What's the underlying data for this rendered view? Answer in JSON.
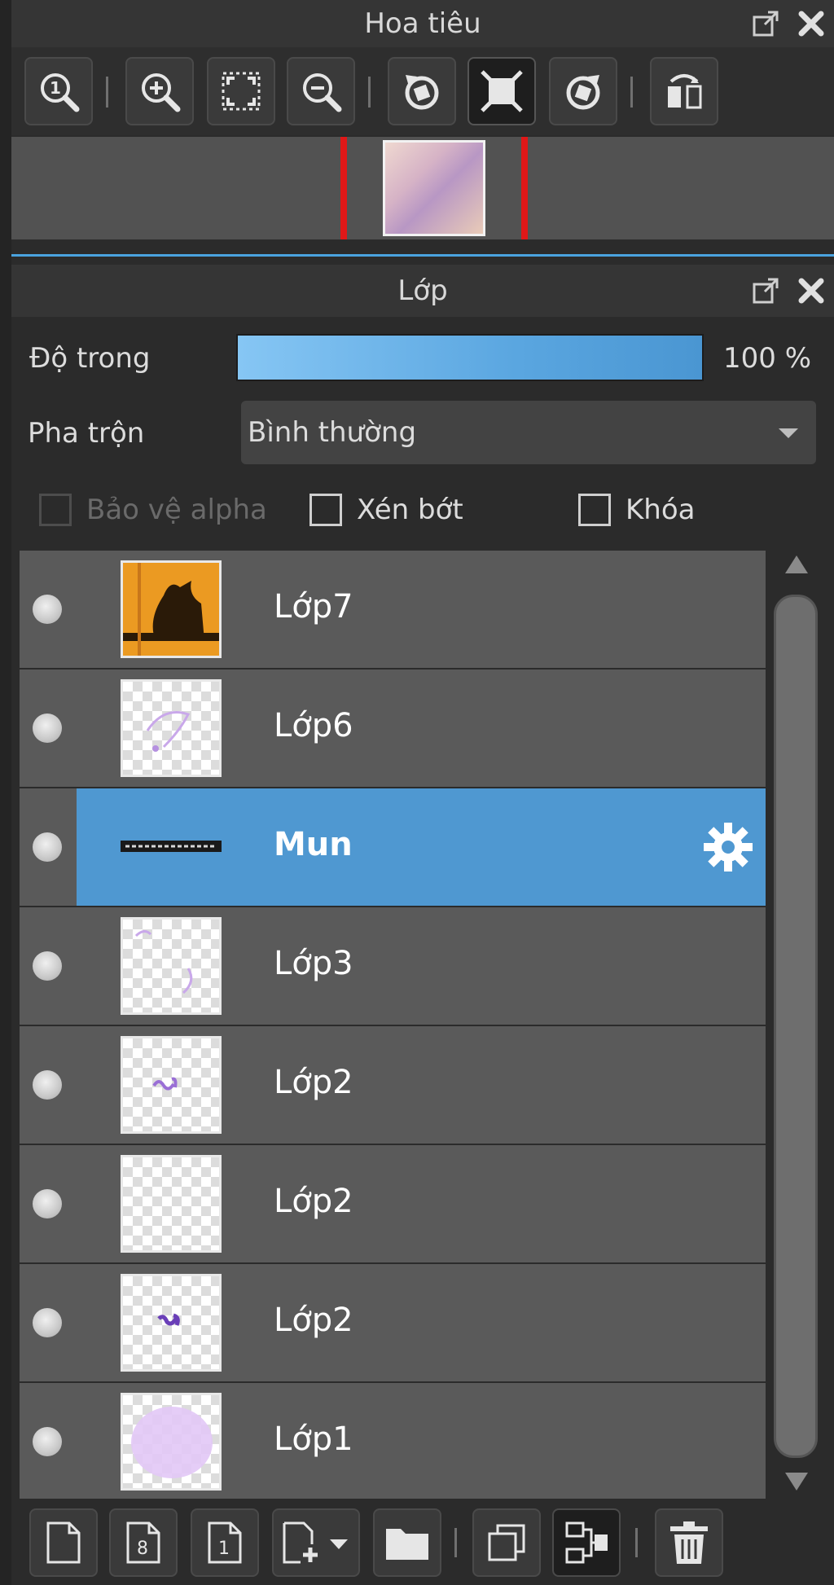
{
  "navigator": {
    "title": "Hoa tiêu",
    "toolbar": [
      {
        "icon": "zoom-actual-icon"
      },
      {
        "icon": "zoom-in-icon"
      },
      {
        "icon": "fit-screen-icon"
      },
      {
        "icon": "zoom-out-icon"
      },
      {
        "icon": "rotate-left-icon"
      },
      {
        "icon": "reset-view-icon"
      },
      {
        "icon": "rotate-right-icon"
      },
      {
        "icon": "flip-horizontal-icon"
      }
    ]
  },
  "layers_panel": {
    "title": "Lớp",
    "opacity_label": "Độ trong",
    "opacity_value": "100 %",
    "opacity_percent": 100,
    "blend_label": "Pha trộn",
    "blend_value": "Bình thường",
    "protect_alpha_label": "Bảo vệ alpha",
    "clipping_label": "Xén bớt",
    "lock_label": "Khóa",
    "layers": [
      {
        "name": "Lớp7",
        "thumb": "orange-silhouette"
      },
      {
        "name": "Lớp6",
        "thumb": "transparent-sketch"
      },
      {
        "name": "Mun",
        "thumb": "strip",
        "selected": true
      },
      {
        "name": "Lớp3",
        "thumb": "transparent-sketch"
      },
      {
        "name": "Lớp2",
        "thumb": "transparent-mark"
      },
      {
        "name": "Lớp2",
        "thumb": "transparent"
      },
      {
        "name": "Lớp2",
        "thumb": "transparent-mark"
      },
      {
        "name": "Lớp1",
        "thumb": "lavender"
      }
    ]
  },
  "bottom_toolbar": [
    {
      "icon": "new-layer-icon"
    },
    {
      "icon": "new-8bit-layer-icon"
    },
    {
      "icon": "new-1bit-layer-icon"
    },
    {
      "icon": "add-layer-menu-icon"
    },
    {
      "icon": "folder-icon"
    },
    {
      "icon": "duplicate-layer-icon"
    },
    {
      "icon": "merge-down-icon"
    },
    {
      "icon": "delete-icon"
    }
  ],
  "colors": {
    "accent": "#4f98d1",
    "panel_bg": "#2b2b2b",
    "row_bg": "#5a5a5a",
    "highlight_line": "#e01818"
  }
}
